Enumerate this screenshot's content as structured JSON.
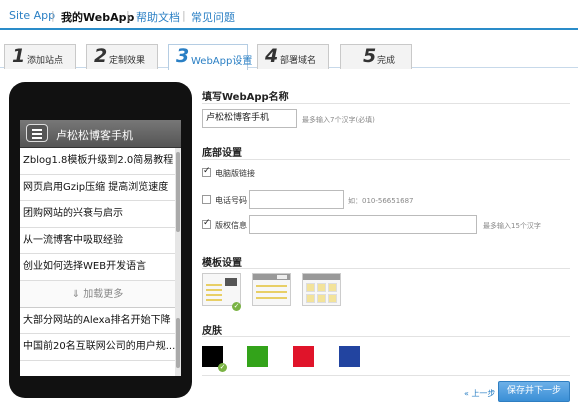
{
  "topnav": {
    "items": [
      "Site App",
      "我的WebApp",
      "帮助文档",
      "常见问题"
    ]
  },
  "steps": [
    {
      "num": "1",
      "label": "添加站点"
    },
    {
      "num": "2",
      "label": "定制效果"
    },
    {
      "num": "3",
      "label": "WebApp设置"
    },
    {
      "num": "4",
      "label": "部署域名"
    },
    {
      "num": "5",
      "label": "完成"
    }
  ],
  "phone": {
    "title": "卢松松博客手机",
    "items": [
      "Zblog1.8模板升级到2.0简易教程",
      "网页启用Gzip压缩 提高浏览速度",
      "团购网站的兴衰与启示",
      "从一流博客中吸取经验",
      "创业如何选择WEB开发语言"
    ],
    "more": "⇓ 加载更多",
    "items2": [
      "大部分网站的Alexa排名开始下降",
      "中国前20名互联网公司的用户规..."
    ]
  },
  "settings": {
    "name_section": "填写WebApp名称",
    "name_value": "卢松松博客手机",
    "name_hint": "最多输入7个汉字(必填)",
    "footer_section": "底部设置",
    "computer_link_label": "电脑版链接",
    "phone_label": "电话号码",
    "phone_hint": "如：010-56651687",
    "copyright_label": "版权信息",
    "copyright_hint": "最多输入15个汉字",
    "template_section": "模板设置",
    "skin_section": "皮肤"
  },
  "skins": [
    "#000000",
    "#33a31a",
    "#e0142a",
    "#2244a0"
  ],
  "actions": {
    "prev": "« 上一步",
    "next": "保存并下一步"
  }
}
